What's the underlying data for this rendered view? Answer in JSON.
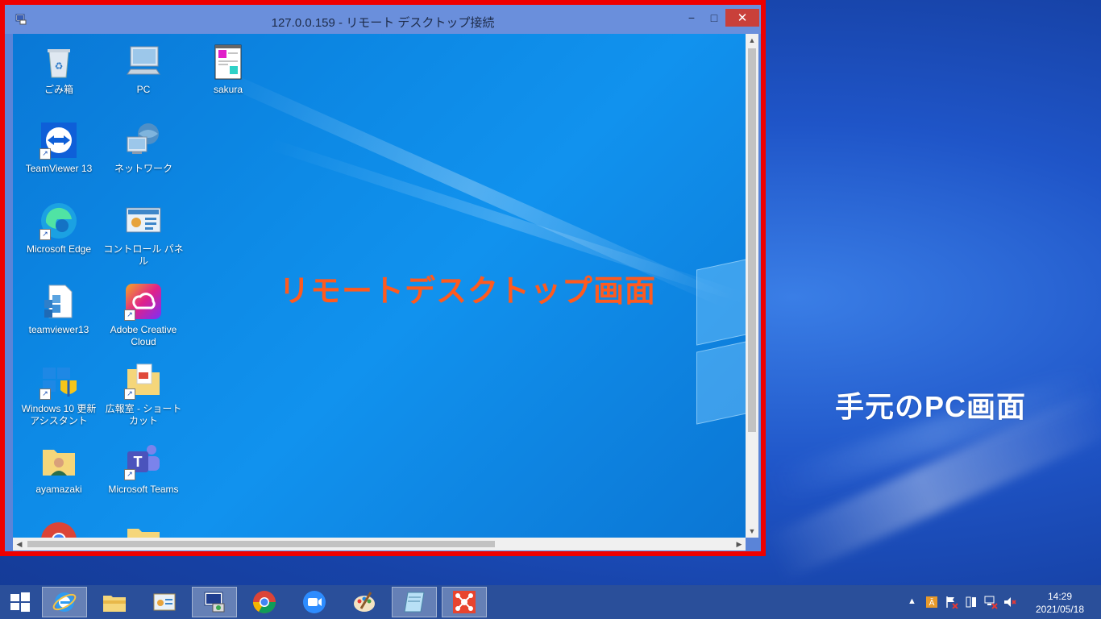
{
  "local": {
    "annotation": "手元のPC画面"
  },
  "rdp": {
    "title": "127.0.0.159 - リモート デスクトップ接続",
    "buttons": {
      "minimize": "−",
      "maximize": "□",
      "close": "✕"
    },
    "annotation": "リモートデスクトップ画面",
    "icons": [
      {
        "label": "ごみ箱",
        "icon": "recycle-bin-icon"
      },
      {
        "label": "PC",
        "icon": "pc-icon"
      },
      {
        "label": "sakura",
        "icon": "sakura-editor-icon"
      },
      {
        "label": "TeamViewer 13",
        "icon": "teamviewer-icon"
      },
      {
        "label": "ネットワーク",
        "icon": "network-icon"
      },
      {
        "label": "Microsoft Edge",
        "icon": "edge-icon"
      },
      {
        "label": "コントロール パネル",
        "icon": "control-panel-icon"
      },
      {
        "label": "teamviewer13",
        "icon": "installer-icon"
      },
      {
        "label": "Adobe Creative Cloud",
        "icon": "creative-cloud-icon"
      },
      {
        "label": "Windows 10 更新アシスタント",
        "icon": "windows-update-assistant-icon"
      },
      {
        "label": "広報室 - ショートカット",
        "icon": "folder-shortcut-icon"
      },
      {
        "label": "ayamazaki",
        "icon": "user-folder-icon"
      },
      {
        "label": "Microsoft Teams",
        "icon": "teams-icon"
      }
    ]
  },
  "taskbar": {
    "apps": [
      "start",
      "internet-explorer",
      "file-explorer",
      "control-panel",
      "remote-desktop",
      "chrome",
      "zoom",
      "paint",
      "notepad",
      "xmind"
    ],
    "clock": {
      "time": "14:29",
      "date": "2021/05/18"
    }
  }
}
